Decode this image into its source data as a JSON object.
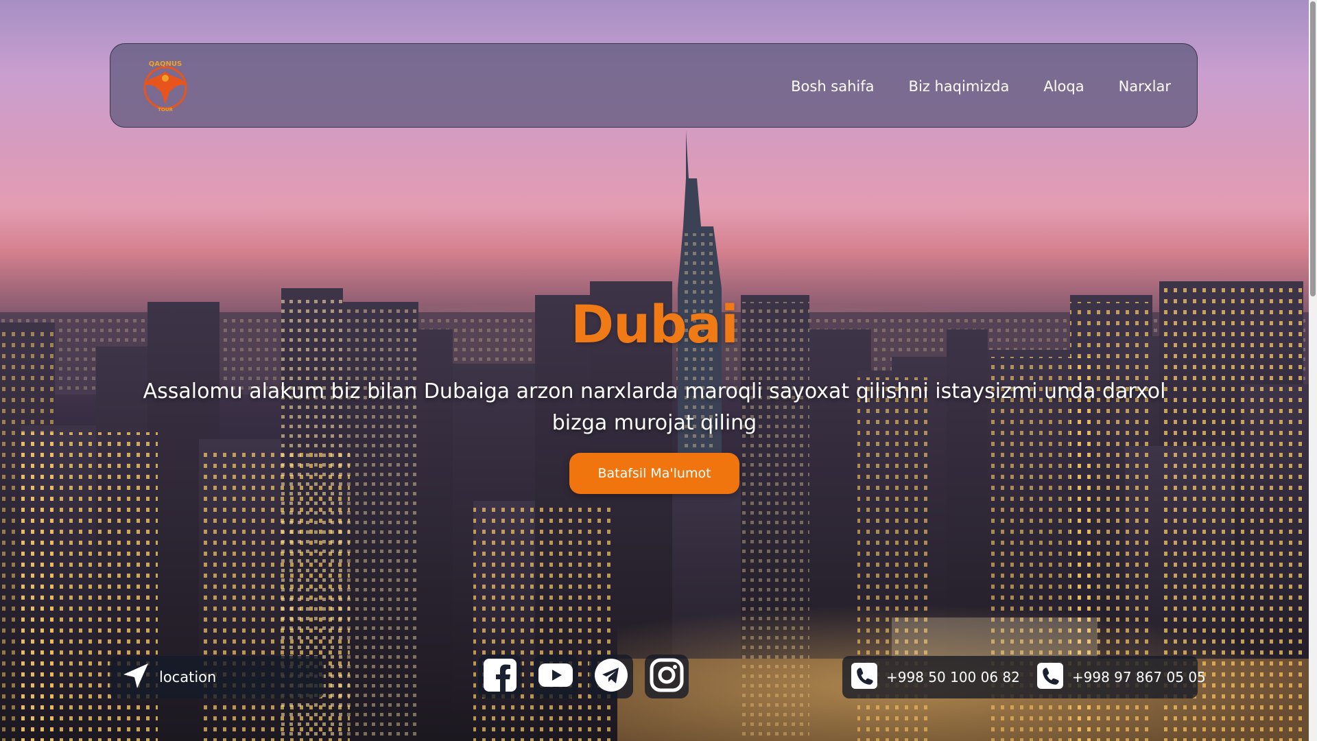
{
  "logo": {
    "text_top": "QAQNUS",
    "text_bottom": "TOUR",
    "color": "#e8551c"
  },
  "nav": {
    "links": [
      {
        "label": "Bosh sahifa"
      },
      {
        "label": "Biz haqimizda"
      },
      {
        "label": "Aloqa"
      },
      {
        "label": "Narxlar"
      }
    ]
  },
  "hero": {
    "title": "Dubai",
    "subtitle": "Assalomu alakum biz bilan Dubaiga arzon narxlarda maroqli sayoxat qilishni istaysizmi unda darxol bizga murojat qiling",
    "cta_label": "Batafsil Ma'lumot",
    "accent_color": "#f0750e"
  },
  "footer": {
    "location_label": "location",
    "socials": [
      {
        "icon": "facebook-icon"
      },
      {
        "icon": "youtube-icon"
      },
      {
        "icon": "telegram-icon"
      },
      {
        "icon": "instagram-icon"
      }
    ],
    "phones": [
      {
        "number": "+998 50 100 06 82"
      },
      {
        "number": "+998 97 867 05 05"
      }
    ]
  }
}
